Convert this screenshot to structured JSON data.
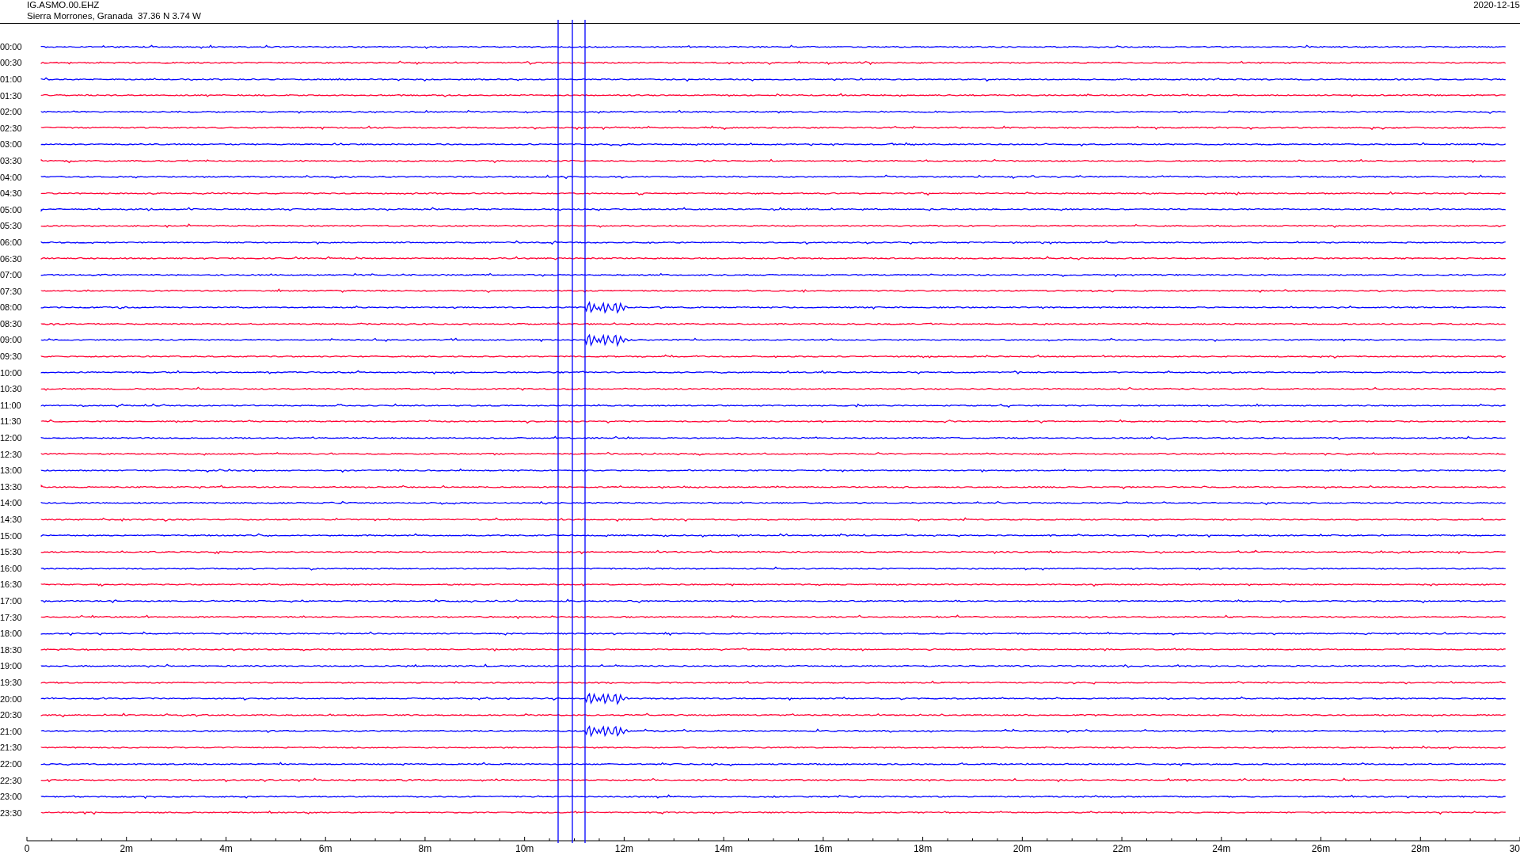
{
  "header": {
    "station": "IG.ASMO.00.EHZ",
    "location": "Sierra Morrones, Granada  37.36 N 3.74 W",
    "date": "2020-12-15"
  },
  "traces": [
    {
      "label": "00:00",
      "color": "#0000ff"
    },
    {
      "label": "00:30",
      "color": "#ff0033"
    },
    {
      "label": "01:00",
      "color": "#0000ff"
    },
    {
      "label": "01:30",
      "color": "#ff0033"
    },
    {
      "label": "02:00",
      "color": "#0000ff"
    },
    {
      "label": "02:30",
      "color": "#ff0033"
    },
    {
      "label": "03:00",
      "color": "#0000ff"
    },
    {
      "label": "03:30",
      "color": "#ff0033"
    },
    {
      "label": "04:00",
      "color": "#0000ff"
    },
    {
      "label": "04:30",
      "color": "#ff0033"
    },
    {
      "label": "05:00",
      "color": "#0000ff"
    },
    {
      "label": "05:30",
      "color": "#ff0033"
    },
    {
      "label": "06:00",
      "color": "#0000ff"
    },
    {
      "label": "06:30",
      "color": "#ff0033"
    },
    {
      "label": "07:00",
      "color": "#0000ff"
    },
    {
      "label": "07:30",
      "color": "#ff0033"
    },
    {
      "label": "08:00",
      "color": "#0000ff"
    },
    {
      "label": "08:30",
      "color": "#ff0033"
    },
    {
      "label": "09:00",
      "color": "#0000ff"
    },
    {
      "label": "09:30",
      "color": "#ff0033"
    },
    {
      "label": "10:00",
      "color": "#0000ff"
    },
    {
      "label": "10:30",
      "color": "#ff0033"
    },
    {
      "label": "11:00",
      "color": "#0000ff"
    },
    {
      "label": "11:30",
      "color": "#ff0033"
    },
    {
      "label": "12:00",
      "color": "#0000ff"
    },
    {
      "label": "12:30",
      "color": "#ff0033"
    },
    {
      "label": "13:00",
      "color": "#0000ff"
    },
    {
      "label": "13:30",
      "color": "#ff0033"
    },
    {
      "label": "14:00",
      "color": "#0000ff"
    },
    {
      "label": "14:30",
      "color": "#ff0033"
    },
    {
      "label": "15:00",
      "color": "#0000ff"
    },
    {
      "label": "15:30",
      "color": "#ff0033"
    },
    {
      "label": "16:00",
      "color": "#0000ff"
    },
    {
      "label": "16:30",
      "color": "#ff0033"
    },
    {
      "label": "17:00",
      "color": "#0000ff"
    },
    {
      "label": "17:30",
      "color": "#ff0033"
    },
    {
      "label": "18:00",
      "color": "#0000ff"
    },
    {
      "label": "18:30",
      "color": "#ff0033"
    },
    {
      "label": "19:00",
      "color": "#0000ff"
    },
    {
      "label": "19:30",
      "color": "#ff0033"
    },
    {
      "label": "20:00",
      "color": "#0000ff"
    },
    {
      "label": "20:30",
      "color": "#ff0033"
    },
    {
      "label": "21:00",
      "color": "#0000ff"
    },
    {
      "label": "21:30",
      "color": "#ff0033"
    },
    {
      "label": "22:00",
      "color": "#0000ff"
    },
    {
      "label": "22:30",
      "color": "#ff0033"
    },
    {
      "label": "23:00",
      "color": "#0000ff"
    },
    {
      "label": "23:30",
      "color": "#ff0033"
    }
  ],
  "x_axis": {
    "ticks": [
      "0",
      "2m",
      "4m",
      "6m",
      "8m",
      "10m",
      "12m",
      "14m",
      "16m",
      "18m",
      "20m",
      "22m",
      "24m",
      "26m",
      "28m",
      "30"
    ]
  }
}
